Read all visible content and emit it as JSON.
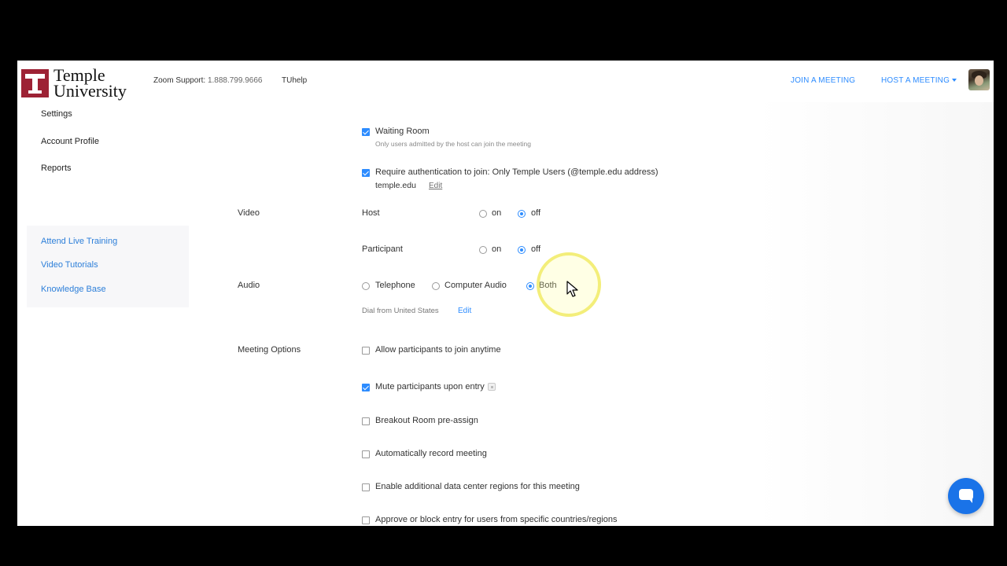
{
  "header": {
    "logo_text_line1": "Temple",
    "logo_text_line2": "University",
    "support_label": "Zoom Support:",
    "support_phone": "1.888.799.9666",
    "tuhelp": "TUhelp",
    "join_meeting": "JOIN A MEETING",
    "host_meeting": "HOST A MEETING"
  },
  "sidebar": {
    "items": [
      {
        "label": "Settings"
      },
      {
        "label": "Account Profile"
      },
      {
        "label": "Reports"
      }
    ],
    "help_links": [
      {
        "label": "Attend Live Training"
      },
      {
        "label": "Video Tutorials"
      },
      {
        "label": "Knowledge Base"
      }
    ]
  },
  "security": {
    "waiting_room": {
      "label": "Waiting Room",
      "checked": true,
      "description": "Only users admitted by the host can join the meeting"
    },
    "require_auth": {
      "label": "Require authentication to join: Only Temple Users (@temple.edu address)",
      "checked": true,
      "domain": "temple.edu",
      "edit": "Edit"
    }
  },
  "video": {
    "section_label": "Video",
    "host": {
      "label": "Host",
      "on": "on",
      "off": "off",
      "selected": "off"
    },
    "participant": {
      "label": "Participant",
      "on": "on",
      "off": "off",
      "selected": "off"
    }
  },
  "audio": {
    "section_label": "Audio",
    "options": [
      "Telephone",
      "Computer Audio",
      "Both"
    ],
    "selected": "Both",
    "dial_from": "Dial from United States",
    "edit": "Edit"
  },
  "meeting_options": {
    "section_label": "Meeting Options",
    "items": [
      {
        "label": "Allow participants to join anytime",
        "checked": false
      },
      {
        "label": "Mute participants upon entry",
        "checked": true
      },
      {
        "label": "Breakout Room pre-assign",
        "checked": false
      },
      {
        "label": "Automatically record meeting",
        "checked": false
      },
      {
        "label": "Enable additional data center regions for this meeting",
        "checked": false
      },
      {
        "label": "Approve or block entry for users from specific countries/regions",
        "checked": false
      }
    ]
  },
  "colors": {
    "accent": "#2d8cff",
    "brand": "#9d2235",
    "chat_button": "#1a73e8"
  }
}
